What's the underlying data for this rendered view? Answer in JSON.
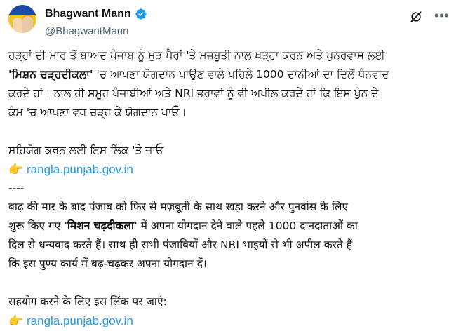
{
  "author": {
    "name": "Bhagwant Mann",
    "handle": "@BhagwantMann"
  },
  "icons": {
    "verified": "verified-badge-icon",
    "grok": "grok-icon",
    "more": "more-options-icon",
    "point": "backhand-index-pointing-right-icon"
  },
  "colors": {
    "link": "#1d9bf0",
    "verified": "#1d9bf0",
    "text": "#0f1419",
    "muted": "#536471"
  },
  "post": {
    "punjabi": {
      "line1": "ਹੜ੍ਹਾਂ ਦੀ ਮਾਰ ਤੋਂ ਬਾਅਦ ਪੰਜਾਬ ਨੂੰ ਮੁੜ ਪੈਰਾਂ 'ਤੇ ਮਜ਼ਬੂਤੀ ਨਾਲ ਖੜ੍ਹਾ ਕਰਨ ਅਤੇ ਪੁਨਰਵਾਸ ਲਈ",
      "line2_strong": "'ਮਿਸ਼ਨ ਚੜ੍ਹਦੀਕਲਾ'",
      "line2_rest": " 'ਚ ਆਪਣਾ ਯੋਗਦਾਨ ਪਾਉਣ ਵਾਲੇ ਪਹਿਲੇ 1000 ਦਾਨੀਆਂ ਦਾ ਦਿਲੋਂ ਧੰਨਵਾਦ",
      "line3": "ਕਰਦੇ ਹਾਂ। ਨਾਲ ਹੀ ਸਮੂਹ ਪੰਜਾਬੀਆਂ ਅਤੇ NRI ਭਰਾਵਾਂ ਨੂੰ ਵੀ ਅਪੀਲ ਕਰਦੇ ਹਾਂ ਕਿ ਇਸ ਪੁੰਨ ਦੇ",
      "line4": "ਕੰਮ 'ਚ ਆਪਣਾ ਵਧ ਚੜ੍ਹ ਕੇ ਯੋਗਦਾਨ ਪਾਓ।",
      "cta": "ਸਹਿਯੋਗ ਕਰਨ ਲਈ ਇਸ ਲਿੰਕ 'ਤੇ ਜਾਓ",
      "link": "rangla.punjab.gov.in"
    },
    "separator": "----",
    "hindi": {
      "line1": "बाढ़ की मार के बाद पंजाब को फिर से मज़बूती के साथ खड़ा करने और पुनर्वास के लिए",
      "line2_pre": "शुरू किए गए ",
      "line2_strong": "'मिशन चढ़दीकला'",
      "line2_rest": " में अपना योगदान देने वाले पहले 1000 दानदाताओं का",
      "line3": "दिल से धन्यवाद करते हैं। साथ ही सभी पंजाबियों और NRI भाइयों से भी अपील करते हैं",
      "line4": "कि इस पुण्य कार्य में बढ़-चढ़कर अपना योगदान दें।",
      "cta": "सहयोग करने के लिए इस लिंक पर जाएं:",
      "link": "rangla.punjab.gov.in"
    }
  }
}
